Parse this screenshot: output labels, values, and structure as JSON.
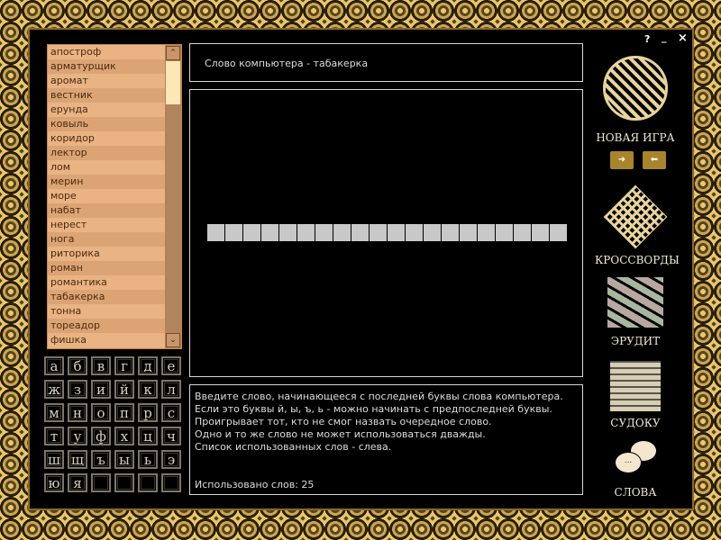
{
  "window_controls": {
    "help": "?",
    "minimize": "_",
    "close": "×"
  },
  "used_words": [
    "апостроф",
    "арматурщик",
    "аромат",
    "вестник",
    "ерунда",
    "ковыль",
    "коридор",
    "лектор",
    "лом",
    "мерин",
    "море",
    "набат",
    "нерест",
    "нога",
    "риторика",
    "роман",
    "романтика",
    "табакерка",
    "тонна",
    "тореадор",
    "фишка"
  ],
  "scrollbar": {
    "up": "⌃",
    "down": "⌄"
  },
  "keyboard": [
    "а",
    "б",
    "в",
    "г",
    "д",
    "е",
    "ж",
    "з",
    "и",
    "й",
    "к",
    "л",
    "м",
    "н",
    "о",
    "п",
    "р",
    "с",
    "т",
    "у",
    "ф",
    "х",
    "ц",
    "ч",
    "ш",
    "щ",
    "ъ",
    "ы",
    "ь",
    "э",
    "ю",
    "я",
    "",
    "",
    "",
    ""
  ],
  "computer_word": "Слово компьютера - табакерка",
  "answer_cells": 20,
  "instructions": [
    "Введите слово, начинающееся с последней буквы слова компьютера.",
    "Если это буквы й, ы, ъ, ь - можно начинать с предпоследней буквы.",
    "Проигрывает тот, кто не смог назвать очередное слово.",
    "Одно и то же слово не может использоваться дважды.",
    "Список использованных слов - слева."
  ],
  "used_count": "Использовано слов: 25",
  "menu": {
    "new_game": "НОВАЯ ИГРА",
    "crosswords": "КРОССВОРДЫ",
    "erudit": "ЭРУДИТ",
    "sudoku": "СУДОКУ",
    "words": "СЛОВА"
  }
}
